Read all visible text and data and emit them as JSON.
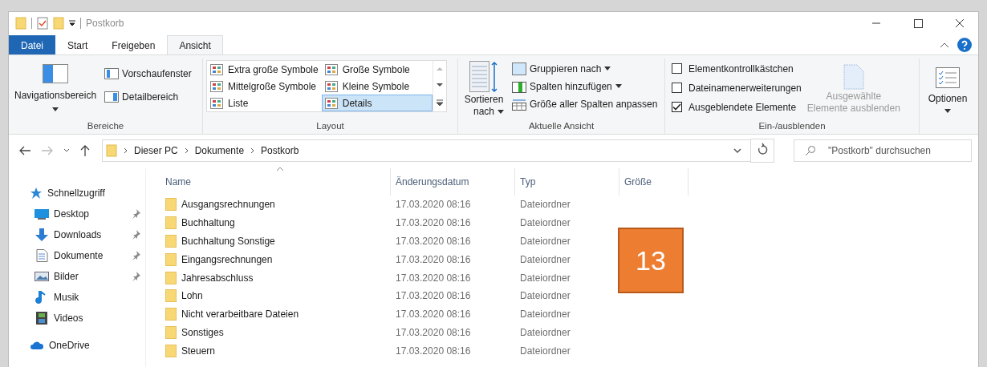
{
  "window": {
    "title": "Postkorb"
  },
  "ribbon_tabs": [
    {
      "label": "Datei",
      "kind": "file",
      "selected": false
    },
    {
      "label": "Start",
      "kind": "tab",
      "selected": false
    },
    {
      "label": "Freigeben",
      "kind": "tab",
      "selected": false
    },
    {
      "label": "Ansicht",
      "kind": "tab",
      "selected": true
    }
  ],
  "panes_group": {
    "label": "Bereiche",
    "navigation": "Navigationsbereich",
    "preview": "Vorschaufenster",
    "details": "Detailbereich"
  },
  "layout_group": {
    "label": "Layout",
    "items": [
      {
        "label": "Extra große Symbole",
        "selected": false
      },
      {
        "label": "Große Symbole",
        "selected": false
      },
      {
        "label": "Mittelgroße Symbole",
        "selected": false
      },
      {
        "label": "Kleine Symbole",
        "selected": false
      },
      {
        "label": "Liste",
        "selected": false
      },
      {
        "label": "Details",
        "selected": true
      }
    ]
  },
  "view_group": {
    "label": "Aktuelle Ansicht",
    "sort_lines": [
      "Sortieren",
      "nach"
    ],
    "group_by": "Gruppieren nach",
    "add_columns": "Spalten hinzufügen",
    "fit_columns": "Größe aller Spalten anpassen"
  },
  "show_group": {
    "label": "Ein-/ausblenden",
    "checkboxes": [
      {
        "label": "Elementkontrollkästchen",
        "checked": false
      },
      {
        "label": "Dateinamenerweiterungen",
        "checked": false
      },
      {
        "label": "Ausgeblendete Elemente",
        "checked": true
      }
    ],
    "hide_lines": [
      "Ausgewählte",
      "Elemente ausblenden"
    ]
  },
  "options": {
    "label": "Optionen"
  },
  "address": {
    "path": [
      "Dieser PC",
      "Dokumente",
      "Postkorb"
    ],
    "search_placeholder": "\"Postkorb\" durchsuchen"
  },
  "sidebar": {
    "items": [
      {
        "label": "Schnellzugriff",
        "kind": "quick",
        "children": [
          {
            "label": "Desktop",
            "kind": "desktop",
            "pinned": true
          },
          {
            "label": "Downloads",
            "kind": "download",
            "pinned": true
          },
          {
            "label": "Dokumente",
            "kind": "document",
            "pinned": true
          },
          {
            "label": "Bilder",
            "kind": "pictures",
            "pinned": true
          },
          {
            "label": "Musik",
            "kind": "music",
            "pinned": false
          },
          {
            "label": "Videos",
            "kind": "video",
            "pinned": false
          }
        ]
      },
      {
        "label": "OneDrive",
        "kind": "cloud"
      }
    ]
  },
  "table": {
    "columns": [
      "Name",
      "Änderungsdatum",
      "Typ",
      "Größe"
    ],
    "rows": [
      [
        "Ausgangsrechnungen",
        "17.03.2020 08:16",
        "Dateiordner"
      ],
      [
        "Buchhaltung",
        "17.03.2020 08:16",
        "Dateiordner"
      ],
      [
        "Buchhaltung Sonstige",
        "17.03.2020 08:16",
        "Dateiordner"
      ],
      [
        "Eingangsrechnungen",
        "17.03.2020 08:16",
        "Dateiordner"
      ],
      [
        "Jahresabschluss",
        "17.03.2020 08:16",
        "Dateiordner"
      ],
      [
        "Lohn",
        "17.03.2020 08:16",
        "Dateiordner"
      ],
      [
        "Nicht verarbeitbare Dateien",
        "17.03.2020 08:16",
        "Dateiordner"
      ],
      [
        "Sonstiges",
        "17.03.2020 08:16",
        "Dateiordner"
      ],
      [
        "Steuern",
        "17.03.2020 08:16",
        "Dateiordner"
      ]
    ]
  },
  "step_badge": "13"
}
